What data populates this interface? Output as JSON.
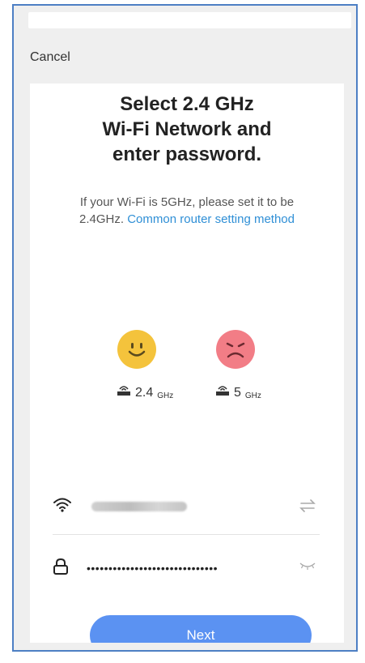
{
  "header": {
    "cancel_label": "Cancel"
  },
  "title": {
    "line1": "Select 2.4 GHz",
    "line2": "Wi-Fi Network and",
    "line3": "enter password."
  },
  "description": {
    "text": "If your Wi-Fi is 5GHz, please set it to be 2.4GHz.",
    "link": "Common router setting method"
  },
  "bands": [
    {
      "value": "2.4",
      "unit": "GHz",
      "mood": "happy-face-icon"
    },
    {
      "value": "5",
      "unit": "GHz",
      "mood": "sad-face-icon"
    }
  ],
  "form": {
    "wifi_icon": "wifi-icon",
    "switch_icon": "switch-network-icon",
    "lock_icon": "lock-icon",
    "password_masked": "••••••••••••••••••••••••••••••",
    "visibility_icon": "eye-closed-icon"
  },
  "next_label": "Next",
  "colors": {
    "accent": "#5b92f2",
    "link": "#2f8fd6",
    "happy": "#f4c33c",
    "sad": "#f27d86"
  }
}
